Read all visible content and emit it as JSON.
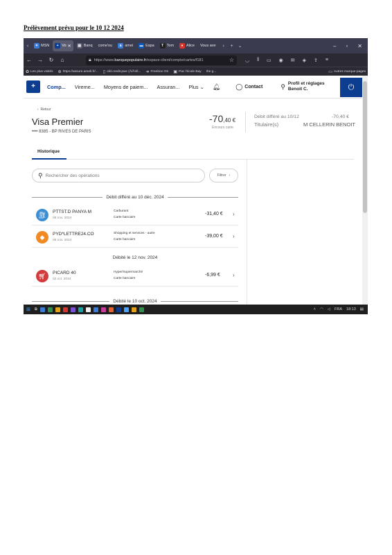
{
  "document": {
    "title": "Prélèvement prévu pour le 10 12 2024"
  },
  "browser": {
    "tabs": [
      {
        "label": "MSN",
        "icon": "msn-icon",
        "color": "#3a7bd5"
      },
      {
        "label": "Vo",
        "icon": "bp-icon",
        "color": "#0c3d91",
        "active": true
      },
      {
        "label": "Banq",
        "icon": "bank-icon",
        "color": "#5a5a6e"
      },
      {
        "label": "come'ou",
        "icon": "page-icon",
        "color": "#6e6e7e"
      },
      {
        "label": "amei",
        "icon": "ameli-icon",
        "color": "#3a7bd5"
      },
      {
        "label": "Espa",
        "icon": "space-icon",
        "color": "#0a59b8"
      },
      {
        "label": "Tom",
        "icon": "t-icon",
        "color": "#222222"
      },
      {
        "label": "Alice",
        "icon": "alice-icon",
        "color": "#d8342b"
      },
      {
        "label": "Vous ave",
        "icon": "mail-icon",
        "color": "#5a5a6e"
      }
    ],
    "url_prefix": "https://www.",
    "url_host": "banquepopulaire.fr",
    "url_path": "/espace-client/compte/cartes/f181",
    "bookmarks": [
      "Les plus visités",
      "https://assure.ameli.fr/...",
      "cikl.credit.pwc (Ä/Ã¤ll...",
      "Freebox OS",
      "Pac l'école Bay",
      "Ihe g..."
    ],
    "bookmarks_other": "Autres marque-pages"
  },
  "nav": {
    "items": [
      "Comp...",
      "Vireme...",
      "Moyens de paiem...",
      "Assuran...",
      "Plus"
    ],
    "contact": "Contact",
    "profile_title": "Profil et réglages",
    "profile_name": "Benoit C."
  },
  "card": {
    "back": "Retour",
    "name": "Visa Premier",
    "number": "•••• 8385 - BP RIVES DE PARIS",
    "outstanding_int": "-70",
    "outstanding_dec": ",40 €",
    "outstanding_label": "Encours carte",
    "deferred_label": "Débit différé au 10/12",
    "deferred_amount": "-70,40 €",
    "holder_label": "Titulaire(s)",
    "holder_name": "M CELLERIN BENOIT"
  },
  "history": {
    "tab": "Historique",
    "search_placeholder": "Rechercher des opérations",
    "filter_label": "Filtrer",
    "groups": [
      {
        "title": "Débit différé au 10 déc. 2024",
        "operations": [
          {
            "name": "PTTST.D PANYA M",
            "date": "08 nov. 2024",
            "category": "Carburant",
            "type": "Carte bancaire",
            "amount": "-31,40 €",
            "icon": "fuel-icon",
            "color": "#3b8ed4"
          },
          {
            "name": "PYD*LETTRE24.CO",
            "date": "06 nov. 2024",
            "category": "Shopping et services - autre",
            "type": "Carte bancaire",
            "amount": "-39,00 €",
            "icon": "shopping-icon",
            "color": "#f08a24"
          }
        ]
      },
      {
        "title": "Débité le 12 nov. 2024",
        "operations": [
          {
            "name": "PICARD 40",
            "date": "02 oct. 2024",
            "category": "Hyper/supermarché",
            "type": "Carte bancaire",
            "amount": "-6,99 €",
            "icon": "cart-icon",
            "color": "#d33c3c"
          }
        ]
      },
      {
        "title": "Débité le 10 oct. 2024",
        "operations": []
      }
    ]
  },
  "taskbar": {
    "lang": "FRA",
    "time": "18:13"
  }
}
